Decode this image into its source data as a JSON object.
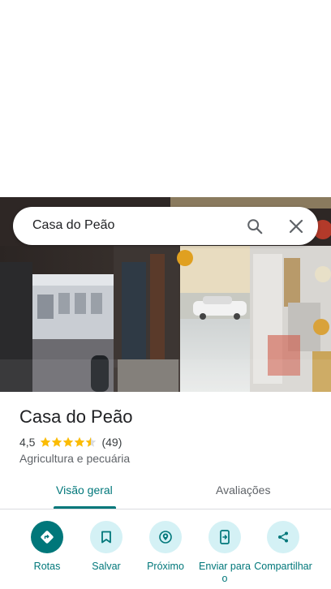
{
  "search": {
    "query": "Casa do Peão"
  },
  "place": {
    "name": "Casa do Peão",
    "rating": "4,5",
    "stars": 4.5,
    "reviews_count": "(49)",
    "category": "Agricultura e pecuária"
  },
  "tabs": [
    {
      "label": "Visão geral",
      "active": true
    },
    {
      "label": "Avaliações",
      "active": false
    }
  ],
  "actions": [
    {
      "label": "Rotas",
      "icon": "directions-icon"
    },
    {
      "label": "Salvar",
      "icon": "bookmark-icon"
    },
    {
      "label": "Próximo",
      "icon": "nearby-icon"
    },
    {
      "label": "Enviar para o",
      "icon": "send-to-phone-icon"
    },
    {
      "label": "Compartilhar",
      "icon": "share-icon"
    }
  ],
  "colors": {
    "accent": "#00777a",
    "action_bg": "#d4f1f5",
    "star": "#fbbc04"
  }
}
